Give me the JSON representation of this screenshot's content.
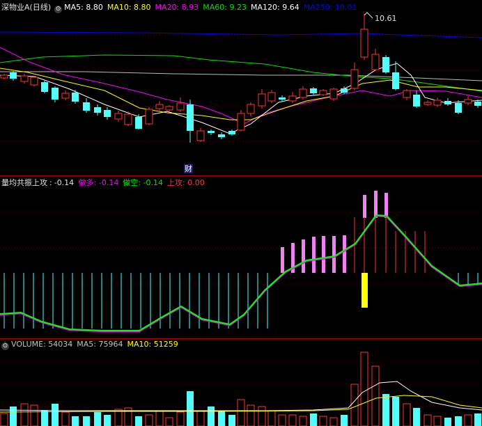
{
  "colors": {
    "up": "#ff3232",
    "down": "#54fcfc",
    "ma5": "#ffffff",
    "ma10": "#ffff00",
    "ma20": "#ff00ff",
    "ma60": "#00e600",
    "ma120": "#bbbbbb",
    "ma250": "#0000ff",
    "dea": "#00ff00",
    "dif": "#ff00ff",
    "lime": "#00e600",
    "magenta": "#ff00ff",
    "volma5": "#ffffff",
    "volma10": "#ffff00",
    "yellowbar": "#ffff00"
  },
  "price_panel": {
    "title": "深物业A(日线)",
    "icon": "circle-dropdown-icon",
    "icon_glyph": "⊙",
    "ma_labels": [
      {
        "name": "MA5",
        "value": "8.80",
        "color": "#ffffff"
      },
      {
        "name": "MA10",
        "value": "8.80",
        "color": "#ffff00"
      },
      {
        "name": "MA20",
        "value": "8.93",
        "color": "#ff00ff"
      },
      {
        "name": "MA60",
        "value": "9.23",
        "color": "#00e600"
      },
      {
        "name": "MA120",
        "value": "9.64",
        "color": "#ffffff"
      },
      {
        "name": "MA250",
        "value": "10.01",
        "color": "#0000ff"
      }
    ],
    "peak_label": "10.61",
    "event_marker": "财"
  },
  "indicator_panel": {
    "title": "量均共振上攻",
    "value": "-0.14",
    "labels": [
      {
        "name": "做多",
        "value": "-0.14",
        "color": "#ff00ff"
      },
      {
        "name": "做空",
        "value": "-0.14",
        "color": "#00e600"
      },
      {
        "name": "上攻",
        "value": "0.00",
        "color": "#ff3232"
      }
    ]
  },
  "volume_panel": {
    "labels": [
      {
        "name": "VOLUME",
        "value": "54034",
        "color": "#c0c0c0"
      },
      {
        "name": "MA5",
        "value": "75964",
        "color": "#c0c0c0"
      },
      {
        "name": "MA10",
        "value": "51259",
        "color": "#ffff00"
      }
    ]
  }
}
